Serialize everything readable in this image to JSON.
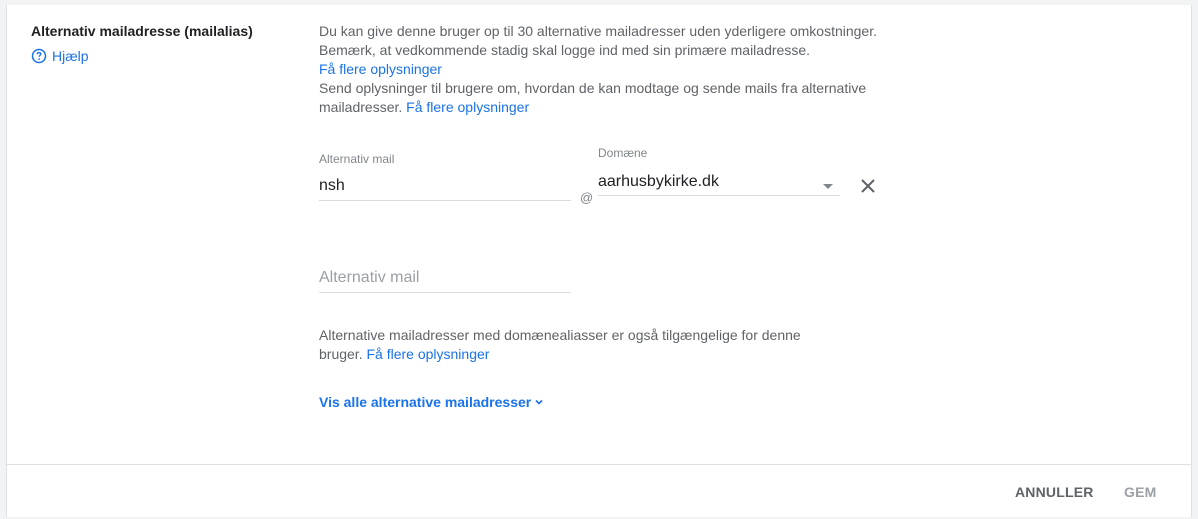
{
  "section": {
    "title": "Alternativ mailadresse (mailalias)",
    "help_label": "Hjælp"
  },
  "description": {
    "line1": "Du kan give denne bruger op til 30 alternative mailadresser uden yderligere omkostninger. Bemærk, at vedkommende stadig skal logge ind med sin primære mailadresse.",
    "link1": "Få flere oplysninger",
    "line2": "Send oplysninger til brugere om, hvordan de kan modtage og sende mails fra alternative mailadresser.",
    "link2": "Få flere oplysninger"
  },
  "alias_row": {
    "mail_label": "Alternativ mail",
    "mail_value": "nsh",
    "at_sign": "@",
    "domain_label": "Domæne",
    "domain_value": "aarhusbykirke.dk"
  },
  "new_alias": {
    "placeholder": "Alternativ mail"
  },
  "note": {
    "text": "Alternative mailadresser med domænealiasser er også tilgængelige for denne bruger.",
    "link": "Få flere oplysninger"
  },
  "show_all_label": "Vis alle alternative mailadresser",
  "footer": {
    "cancel_label": "ANNULLER",
    "save_label": "GEM"
  },
  "colors": {
    "accent": "#1a73e8",
    "text_primary": "#202124",
    "text_secondary": "#5f6368",
    "disabled": "#9aa0a6"
  },
  "icons": {
    "help": "help-circle-icon",
    "dropdown": "dropdown-arrow-icon",
    "close": "close-icon",
    "expand": "chevron-down-icon"
  }
}
